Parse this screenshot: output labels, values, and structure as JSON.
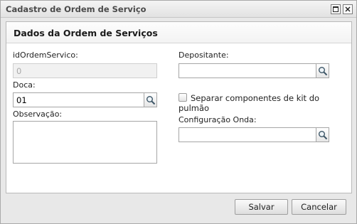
{
  "window": {
    "title": "Cadastro de Ordem de Serviço"
  },
  "panel": {
    "title": "Dados da Ordem de Serviços"
  },
  "form": {
    "id_label": "idOrdemServico:",
    "id_value": "0",
    "doca_label": "Doca:",
    "doca_value": "01",
    "observacao_label": "Observação:",
    "observacao_value": "",
    "depositante_label": "Depositante:",
    "depositante_value": "",
    "separar_label_line1": "Separar componentes de kit do",
    "separar_label_line2": "pulmão",
    "separar_checked": false,
    "config_onda_label": "Configuração Onda:",
    "config_onda_value": ""
  },
  "footer": {
    "save_label": "Salvar",
    "cancel_label": "Cancelar"
  },
  "icons": {
    "maximize": "maximize-icon",
    "close": "close-icon",
    "search": "magnifier-icon"
  }
}
